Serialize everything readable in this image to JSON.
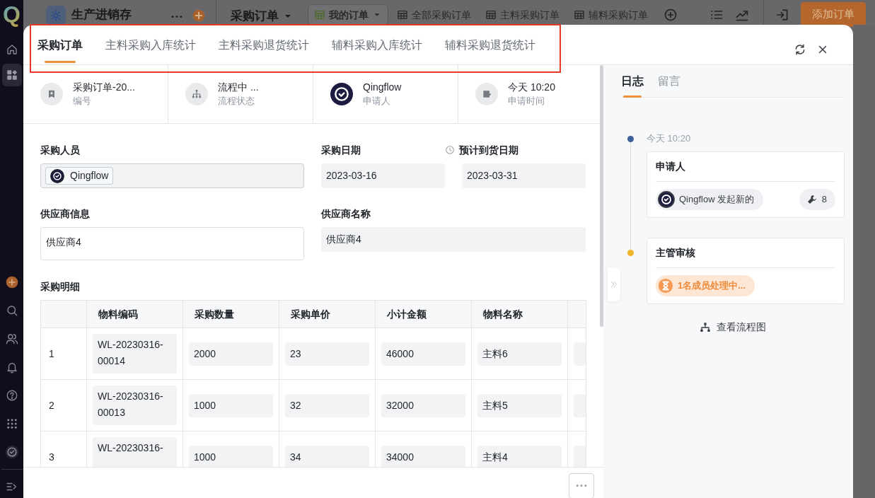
{
  "sidebar": {
    "logo": "Q",
    "top_items": [
      {
        "kind": "home",
        "selected": false
      },
      {
        "kind": "apps",
        "selected": true
      }
    ],
    "bottom_items": [
      {
        "kind": "add",
        "selected": false
      },
      {
        "kind": "search",
        "selected": false
      },
      {
        "kind": "users",
        "selected": false
      },
      {
        "kind": "bell",
        "selected": false
      },
      {
        "kind": "help",
        "selected": false
      },
      {
        "kind": "grid",
        "selected": false
      },
      {
        "kind": "avatar",
        "selected": false
      },
      {
        "kind": "expand",
        "selected": false
      }
    ]
  },
  "app_bar": {
    "app_name": "生产进销存",
    "form_name": "采购订单",
    "add_button": "添加订单",
    "views": [
      {
        "label": "我的订单",
        "selected": true
      },
      {
        "label": "全部采购订单",
        "selected": false
      },
      {
        "label": "主料采购订单",
        "selected": false
      },
      {
        "label": "辅料采购订单",
        "selected": false
      }
    ]
  },
  "modal": {
    "tabs": [
      {
        "label": "采购订单",
        "selected": true
      },
      {
        "label": "主料采购入库统计",
        "selected": false
      },
      {
        "label": "主料采购退货统计",
        "selected": false
      },
      {
        "label": "辅料采购入库统计",
        "selected": false
      },
      {
        "label": "辅料采购退货统计",
        "selected": false
      }
    ],
    "summary": [
      {
        "kind": "code",
        "value": "采购订单-20...",
        "caption": "编号"
      },
      {
        "kind": "flow",
        "value": "流程中 ...",
        "caption": "流程状态"
      },
      {
        "kind": "avatar",
        "value": "Qingflow",
        "caption": "申请人"
      },
      {
        "kind": "time",
        "value": "今天 10:20",
        "caption": "申请时间"
      }
    ],
    "fields": [
      {
        "kind": "member",
        "label": "采购人员",
        "value": "Qingflow"
      },
      {
        "kind": "date",
        "label": "采购日期",
        "value": "2023-03-16",
        "editable": false
      },
      {
        "kind": "date",
        "label": "预计到货日期",
        "value": "2023-03-31",
        "editable": false,
        "timer": true
      },
      {
        "kind": "text",
        "label": "供应商信息",
        "value": "供应商4",
        "editable": true
      },
      {
        "kind": "text",
        "label": "供应商名称",
        "value": "供应商4",
        "editable": false
      }
    ],
    "detail": {
      "title": "采购明细",
      "columns": [
        "物料编码",
        "采购数量",
        "采购单价",
        "小计金额",
        "物料名称"
      ],
      "rows": [
        {
          "index": "1",
          "cells": [
            "WL-20230316-00014",
            "2000",
            "23",
            "46000",
            "主料6"
          ]
        },
        {
          "index": "2",
          "cells": [
            "WL-20230316-00013",
            "1000",
            "32",
            "32000",
            "主料5"
          ]
        },
        {
          "index": "3",
          "cells": [
            "WL-20230316-",
            "1000",
            "34",
            "34000",
            "主料4"
          ]
        }
      ]
    },
    "log": {
      "tabs": [
        {
          "label": "日志",
          "selected": true
        },
        {
          "label": "留言",
          "selected": false
        }
      ],
      "entries": [
        {
          "kind": "submitted",
          "time": "今天 10:20",
          "title": "申请人",
          "color": "#3f5f9a",
          "summary": "Qingflow 发起新的",
          "count": "8"
        },
        {
          "kind": "pending",
          "title": "主管审核",
          "color": "#f0b429",
          "status": "1名成员处理中..."
        }
      ],
      "flow_link": "查看流程图"
    }
  }
}
